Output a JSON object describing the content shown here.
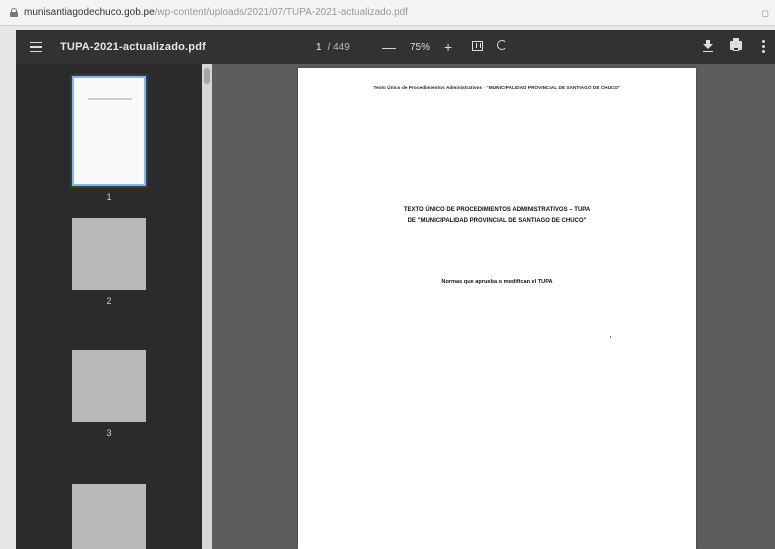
{
  "browser": {
    "host": "munisantiagodechuco.gob.pe",
    "path": "/wp-content/uploads/2021/07/TUPA-2021-actualizado.pdf"
  },
  "toolbar": {
    "title": "TUPA-2021-actualizado.pdf",
    "current_page": "1",
    "total_pages": "/ 449",
    "zoom": "75%",
    "zoom_out": "—",
    "zoom_in": "+"
  },
  "sidebar": {
    "thumbnails": [
      {
        "number": "1",
        "selected": true
      },
      {
        "number": "2",
        "selected": false
      },
      {
        "number": "3",
        "selected": false
      },
      {
        "number": "",
        "selected": false
      }
    ]
  },
  "document": {
    "header": "Texto Único de Procedimientos Administrativos · \"MUNICIPALIDAD PROVINCIAL DE SANTIAGO DE CHUCO\"",
    "title_line1": "TEXTO ÚNICO DE PROCEDIMIENTOS ADMINISTRATIVOS – TUPA",
    "title_line2": "DE \"MUNICIPALIDAD PROVINCIAL DE SANTIAGO DE CHUCO\"",
    "subtitle": "Normas que aprueba o modifican el TUPA"
  },
  "colors": {
    "toolbar_bg": "#323232",
    "sidebar_bg": "#2b2b2b",
    "viewer_bg": "#5d5d5d",
    "selection_accent": "#8ab4f8"
  }
}
